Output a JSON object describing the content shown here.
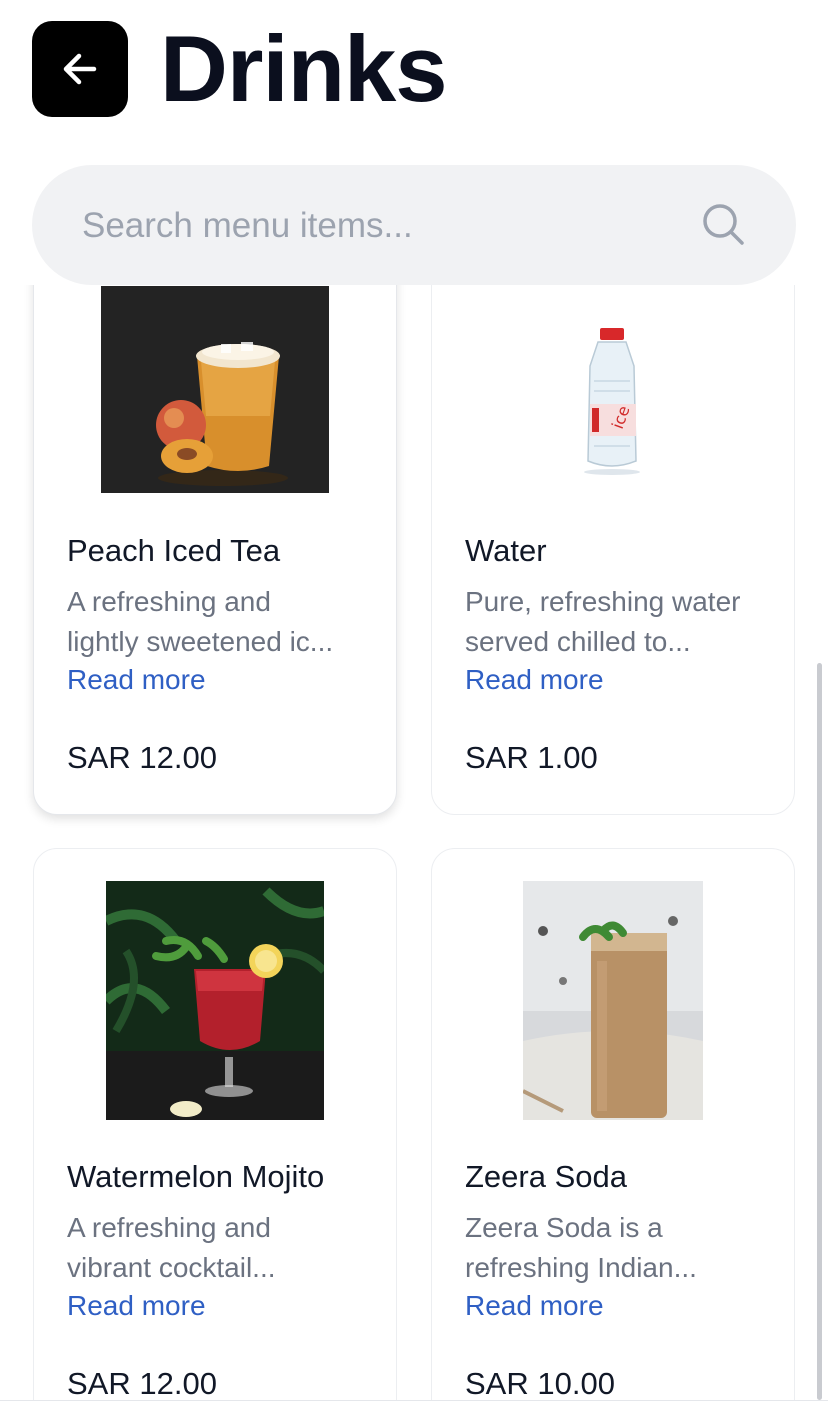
{
  "header": {
    "title": "Drinks",
    "back_icon": "arrow-left-icon"
  },
  "search": {
    "placeholder": "Search menu items...",
    "value": "",
    "icon": "search-icon"
  },
  "items": [
    {
      "name": "Peach Iced Tea",
      "desc_line1": "A refreshing and",
      "desc_line2": "lightly sweetened ic...",
      "read_more": "Read more",
      "price": "SAR 12.00"
    },
    {
      "name": "Water",
      "desc_line1": "Pure, refreshing water",
      "desc_line2": "served chilled to...",
      "read_more": "Read more",
      "price": "SAR 1.00"
    },
    {
      "name": "Watermelon Mojito",
      "desc_line1": "A refreshing and",
      "desc_line2": "vibrant cocktail...",
      "read_more": "Read more",
      "price": "SAR 12.00"
    },
    {
      "name": "Zeera Soda",
      "desc_line1": "Zeera Soda is a",
      "desc_line2": "refreshing Indian...",
      "read_more": "Read more",
      "price": "SAR 10.00"
    }
  ],
  "colors": {
    "accent_link": "#2f5fc4",
    "back_button": "#000000",
    "search_bg": "#f1f2f4"
  }
}
